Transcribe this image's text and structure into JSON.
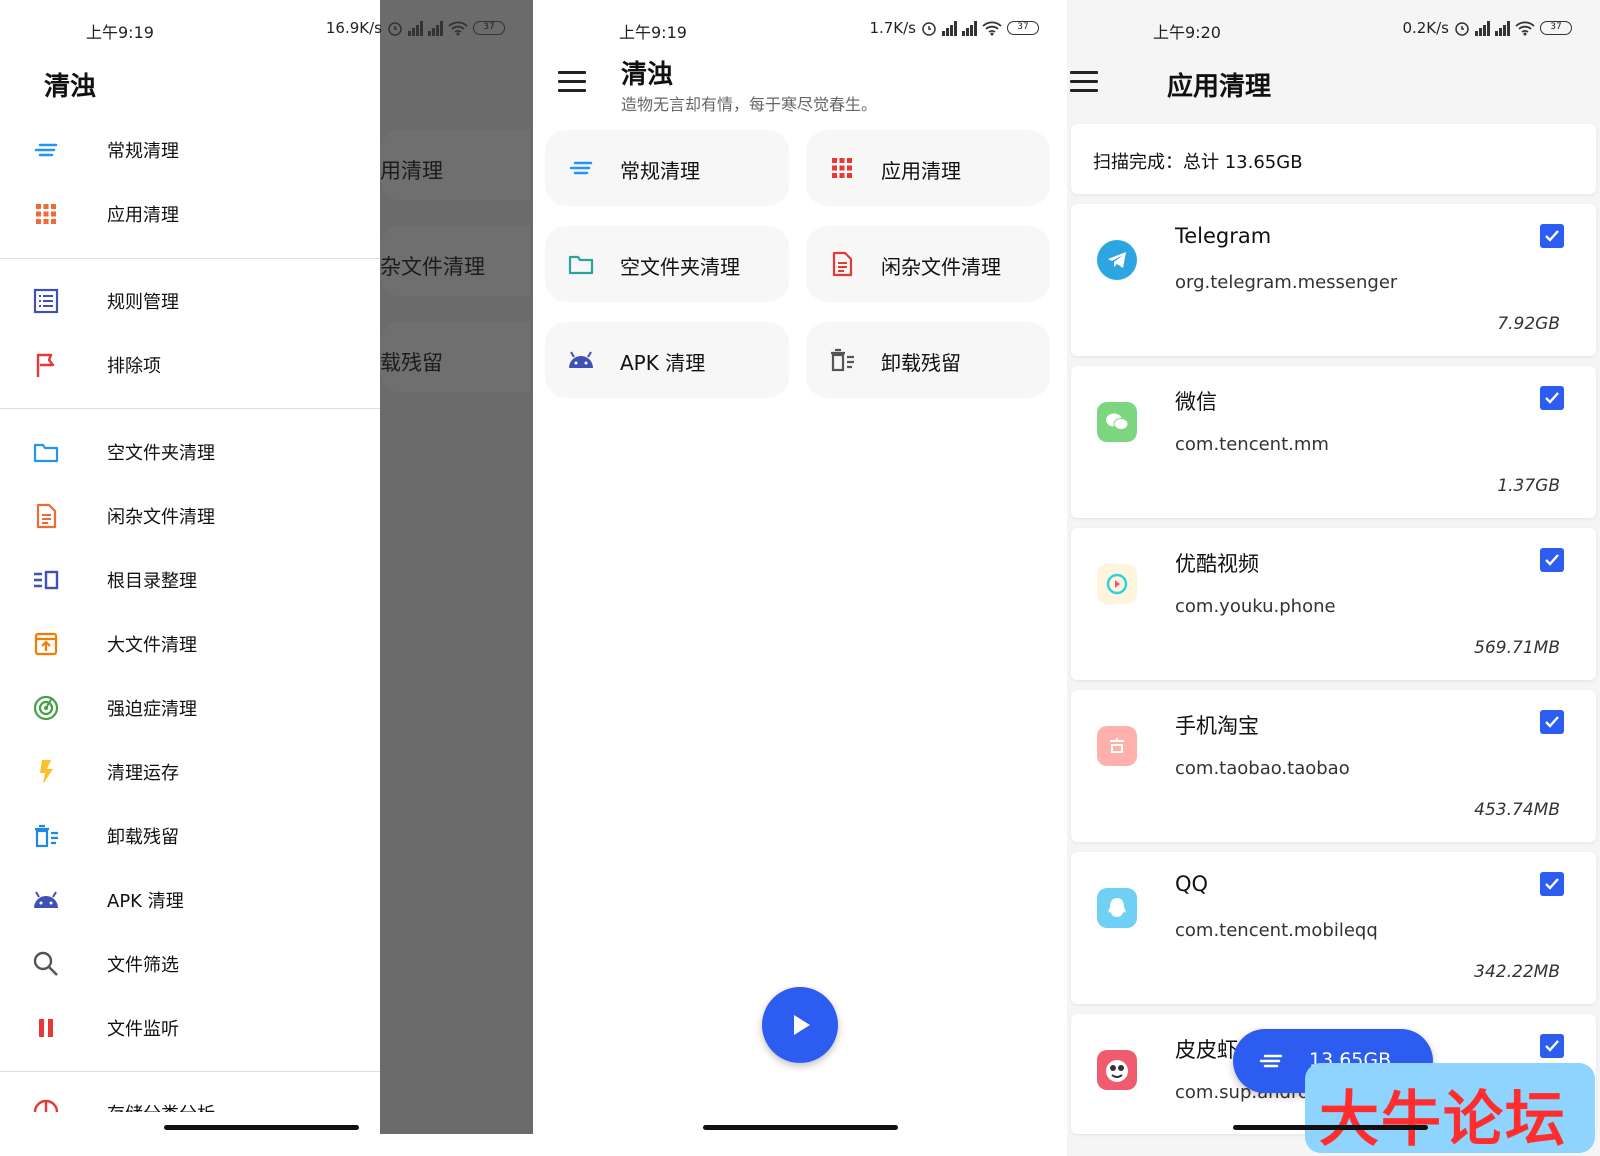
{
  "panel1": {
    "status": {
      "time": "上午9:19",
      "speed": "16.9K/s",
      "battery": "37"
    },
    "drawer_title": "清浊",
    "groups": [
      [
        {
          "label": "常规清理",
          "icon": "sort-lines-icon",
          "color": "#2196f3"
        },
        {
          "label": "应用清理",
          "icon": "app-grid-icon",
          "color": "#f06a35"
        }
      ],
      [
        {
          "label": "规则管理",
          "icon": "rule-list-icon",
          "color": "#3f51b5"
        },
        {
          "label": "排除项",
          "icon": "flag-icon",
          "color": "#e53935"
        }
      ],
      [
        {
          "label": "空文件夹清理",
          "icon": "folder-icon",
          "color": "#2196f3"
        },
        {
          "label": "闲杂文件清理",
          "icon": "document-icon",
          "color": "#f06a35"
        },
        {
          "label": "根目录整理",
          "icon": "root-dir-icon",
          "color": "#3f51b5"
        },
        {
          "label": "大文件清理",
          "icon": "archive-box-icon",
          "color": "#f57c00"
        },
        {
          "label": "强迫症清理",
          "icon": "target-icon",
          "color": "#43a047"
        },
        {
          "label": "清理运存",
          "icon": "lightning-icon",
          "color": "#fbc02d"
        },
        {
          "label": "卸载残留",
          "icon": "uninstall-residue-icon",
          "color": "#1e88e5"
        },
        {
          "label": "APK 清理",
          "icon": "android-icon",
          "color": "#3f51b5"
        },
        {
          "label": "文件筛选",
          "icon": "search-icon",
          "color": "#555555"
        },
        {
          "label": "文件监听",
          "icon": "pause-icon",
          "color": "#e53935"
        }
      ],
      [
        {
          "label": "存储分类分析",
          "icon": "pie-icon",
          "color": "#e53935"
        }
      ]
    ],
    "scrim_items": [
      "用清理",
      "杂文件清理",
      "载残留"
    ]
  },
  "panel2": {
    "status": {
      "time": "上午9:19",
      "speed": "1.7K/s",
      "battery": "37"
    },
    "title": "清浊",
    "subtitle": "造物无言却有情，每于寒尽觉春生。",
    "cards": [
      {
        "label": "常规清理",
        "icon": "sort-lines-icon",
        "color": "#2196f3"
      },
      {
        "label": "应用清理",
        "icon": "app-grid-icon",
        "color": "#e53935"
      },
      {
        "label": "空文件夹清理",
        "icon": "folder-icon",
        "color": "#26a69a"
      },
      {
        "label": "闲杂文件清理",
        "icon": "document-icon",
        "color": "#e53935"
      },
      {
        "label": "APK 清理",
        "icon": "android-icon",
        "color": "#3f51b5"
      },
      {
        "label": "卸载残留",
        "icon": "uninstall-residue-icon",
        "color": "#555555"
      }
    ]
  },
  "panel3": {
    "status": {
      "time": "上午9:20",
      "speed": "0.2K/s",
      "battery": "37"
    },
    "title": "应用清理",
    "scan_summary": "扫描完成：总计 13.65GB",
    "apps": [
      {
        "name": "Telegram",
        "package": "org.telegram.messenger",
        "size": "7.92GB",
        "icon_color": "#2ca5e0",
        "icon": "telegram-icon"
      },
      {
        "name": "微信",
        "package": "com.tencent.mm",
        "size": "1.37GB",
        "icon_color": "#7cd67f",
        "icon": "wechat-icon"
      },
      {
        "name": "优酷视频",
        "package": "com.youku.phone",
        "size": "569.71MB",
        "icon_color": "#fff4dc",
        "icon": "youku-icon"
      },
      {
        "name": "手机淘宝",
        "package": "com.taobao.taobao",
        "size": "453.74MB",
        "icon_color": "#ffb0ad",
        "icon": "taobao-icon"
      },
      {
        "name": "QQ",
        "package": "com.tencent.mobileqq",
        "size": "342.22MB",
        "icon_color": "#6fd0f4",
        "icon": "qq-icon"
      },
      {
        "name": "皮皮虾",
        "package": "com.sup.android",
        "size": "",
        "icon_color": "#f05b70",
        "icon": "pipixia-icon"
      }
    ],
    "fab_total": "13.65GB",
    "watermark": "大牛论坛"
  }
}
